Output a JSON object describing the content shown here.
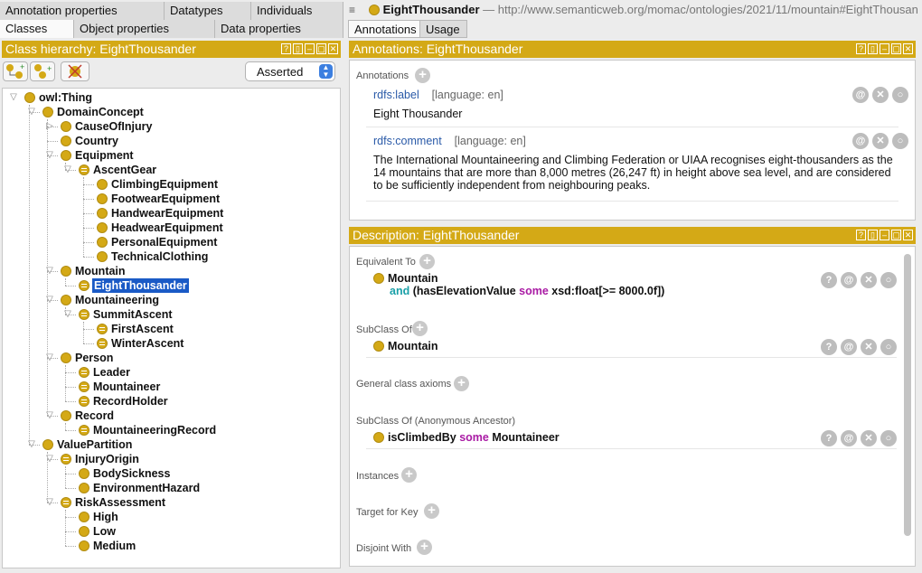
{
  "left": {
    "tabs_row1": [
      "Annotation properties",
      "Datatypes",
      "Individuals"
    ],
    "tabs_row2": [
      "Classes",
      "Object properties",
      "Data properties"
    ],
    "header": "Class hierarchy: EightThousander",
    "mode": "Asserted",
    "tree": [
      {
        "label": "owl:Thing",
        "depth": 0,
        "tw": "▽",
        "eq": false
      },
      {
        "label": "DomainConcept",
        "depth": 1,
        "tw": "▽",
        "eq": false
      },
      {
        "label": "CauseOfInjury",
        "depth": 2,
        "tw": "▷",
        "eq": false
      },
      {
        "label": "Country",
        "depth": 2,
        "tw": "",
        "eq": false
      },
      {
        "label": "Equipment",
        "depth": 2,
        "tw": "▽",
        "eq": false
      },
      {
        "label": "AscentGear",
        "depth": 3,
        "tw": "▽",
        "eq": true
      },
      {
        "label": "ClimbingEquipment",
        "depth": 4,
        "tw": "",
        "eq": false
      },
      {
        "label": "FootwearEquipment",
        "depth": 4,
        "tw": "",
        "eq": false
      },
      {
        "label": "HandwearEquipment",
        "depth": 4,
        "tw": "",
        "eq": false
      },
      {
        "label": "HeadwearEquipment",
        "depth": 4,
        "tw": "",
        "eq": false
      },
      {
        "label": "PersonalEquipment",
        "depth": 4,
        "tw": "",
        "eq": false
      },
      {
        "label": "TechnicalClothing",
        "depth": 4,
        "tw": "",
        "eq": false
      },
      {
        "label": "Mountain",
        "depth": 2,
        "tw": "▽",
        "eq": false
      },
      {
        "label": "EightThousander",
        "depth": 3,
        "tw": "",
        "eq": true,
        "selected": true
      },
      {
        "label": "Mountaineering",
        "depth": 2,
        "tw": "▽",
        "eq": false
      },
      {
        "label": "SummitAscent",
        "depth": 3,
        "tw": "▽",
        "eq": true
      },
      {
        "label": "FirstAscent",
        "depth": 4,
        "tw": "",
        "eq": true
      },
      {
        "label": "WinterAscent",
        "depth": 4,
        "tw": "",
        "eq": true
      },
      {
        "label": "Person",
        "depth": 2,
        "tw": "▽",
        "eq": false
      },
      {
        "label": "Leader",
        "depth": 3,
        "tw": "",
        "eq": true
      },
      {
        "label": "Mountaineer",
        "depth": 3,
        "tw": "",
        "eq": true
      },
      {
        "label": "RecordHolder",
        "depth": 3,
        "tw": "",
        "eq": true
      },
      {
        "label": "Record",
        "depth": 2,
        "tw": "▽",
        "eq": false
      },
      {
        "label": "MountaineeringRecord",
        "depth": 3,
        "tw": "",
        "eq": true
      },
      {
        "label": "ValuePartition",
        "depth": 1,
        "tw": "▽",
        "eq": false
      },
      {
        "label": "InjuryOrigin",
        "depth": 2,
        "tw": "▽",
        "eq": true
      },
      {
        "label": "BodySickness",
        "depth": 3,
        "tw": "",
        "eq": false
      },
      {
        "label": "EnvironmentHazard",
        "depth": 3,
        "tw": "",
        "eq": false
      },
      {
        "label": "RiskAssessment",
        "depth": 2,
        "tw": "▽",
        "eq": true
      },
      {
        "label": "High",
        "depth": 3,
        "tw": "",
        "eq": false
      },
      {
        "label": "Low",
        "depth": 3,
        "tw": "",
        "eq": false
      },
      {
        "label": "Medium",
        "depth": 3,
        "tw": "",
        "eq": false
      }
    ]
  },
  "right": {
    "entity": "EightThousander",
    "iri": "— http://www.semanticweb.org/momac/ontologies/2021/11/mountain#EightThousander",
    "tabs": [
      "Annotations",
      "Usage"
    ],
    "ann_header": "Annotations: EightThousander",
    "ann_section": "Annotations",
    "label_prop": "rdfs:label",
    "label_lang": "[language: en]",
    "label_value": "Eight Thousander",
    "comment_prop": "rdfs:comment",
    "comment_lang": "[language: en]",
    "comment_value": "The International Mountaineering and Climbing Federation or UIAA recognises eight-thousanders as the 14 mountains that are more than 8,000 metres (26,247 ft) in height above sea level, and are considered to be sufficiently independent from neighbouring peaks.",
    "desc_header": "Description: EightThousander",
    "equiv_title": "Equivalent To",
    "equiv_class": "Mountain",
    "equiv_and": "and",
    "equiv_expr1": "(hasElevationValue ",
    "equiv_some": "some",
    "equiv_expr2": " xsd:float[>= 8000.0f])",
    "subclass_title": "SubClass Of",
    "subclass_value": "Mountain",
    "general_title": "General class axioms",
    "anc_title": "SubClass Of (Anonymous Ancestor)",
    "anc_prop": "isClimbedBy",
    "anc_some": "some",
    "anc_class": "Mountaineer",
    "instances_title": "Instances",
    "target_title": "Target for Key",
    "disjoint_title": "Disjoint With"
  }
}
